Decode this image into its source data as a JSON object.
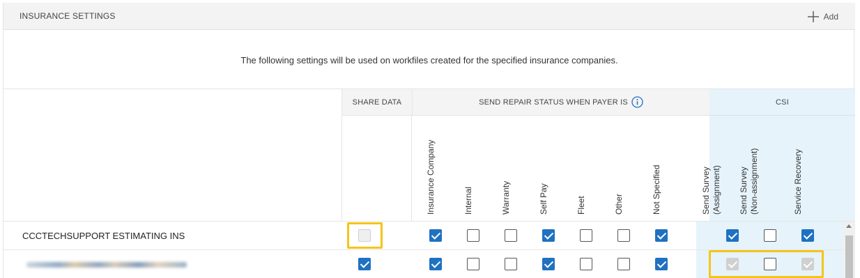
{
  "panel": {
    "title": "INSURANCE SETTINGS",
    "add_label": "Add",
    "description": "The following settings will be used on workfiles created for the specified insurance companies."
  },
  "columns": {
    "share_data": "SHARE DATA",
    "repair_status": "SEND REPAIR STATUS WHEN PAYER IS",
    "csi": "CSI",
    "repair_status_items": [
      "Insurance Company",
      "Internal",
      "Warranty",
      "Self Pay",
      "Fleet",
      "Other",
      "Not Specified"
    ],
    "csi_items": [
      "Send Survey\n(Assignment)",
      "Send Survey\n(Non-assignment)",
      "Service Recovery"
    ]
  },
  "rows": [
    {
      "name": "CCCTECHSUPPORT ESTIMATING INS",
      "share_data": "disabled-unchecked",
      "repair_status": [
        true,
        false,
        false,
        true,
        false,
        false,
        true
      ],
      "csi": [
        "checked",
        "unchecked",
        "checked"
      ]
    },
    {
      "name": "",
      "share_data": "checked",
      "repair_status": [
        true,
        false,
        false,
        true,
        false,
        false,
        true
      ],
      "csi": [
        "disabled-checked",
        "unchecked",
        "disabled-checked"
      ]
    }
  ],
  "colors": {
    "accent": "#1f71c1",
    "highlight": "#f5c518",
    "csi_background": "#e6f3fb"
  }
}
